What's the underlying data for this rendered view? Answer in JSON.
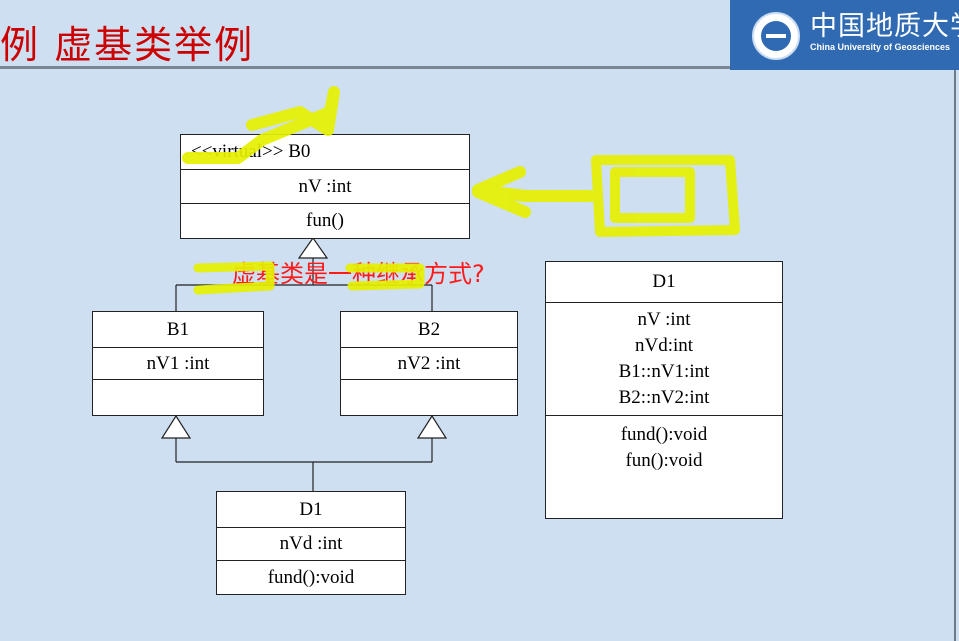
{
  "title": "例 虚基类举例",
  "logo": {
    "cn": "中国地质大学",
    "en": "China University of Geosciences"
  },
  "question": "虚基类是一种继承方式?",
  "classes": {
    "b0": {
      "name": "<<virtual>> B0",
      "attr": "nV :int",
      "method": "fun()"
    },
    "b1": {
      "name": "B1",
      "attr": "nV1 :int"
    },
    "b2": {
      "name": "B2",
      "attr": "nV2 :int"
    },
    "d1": {
      "name": "D1",
      "attr": "nVd :int",
      "method": "fund():void"
    },
    "d1_flat": {
      "name": "D1",
      "attrs": [
        "nV :int",
        "nVd:int",
        "B1::nV1:int",
        "B2::nV2:int"
      ],
      "methods": [
        "fund():void",
        "fun():void"
      ]
    }
  },
  "colors": {
    "title": "#cc0000",
    "question": "#ff1a1a",
    "highlight": "#e6f000",
    "background": "#cddff0"
  }
}
